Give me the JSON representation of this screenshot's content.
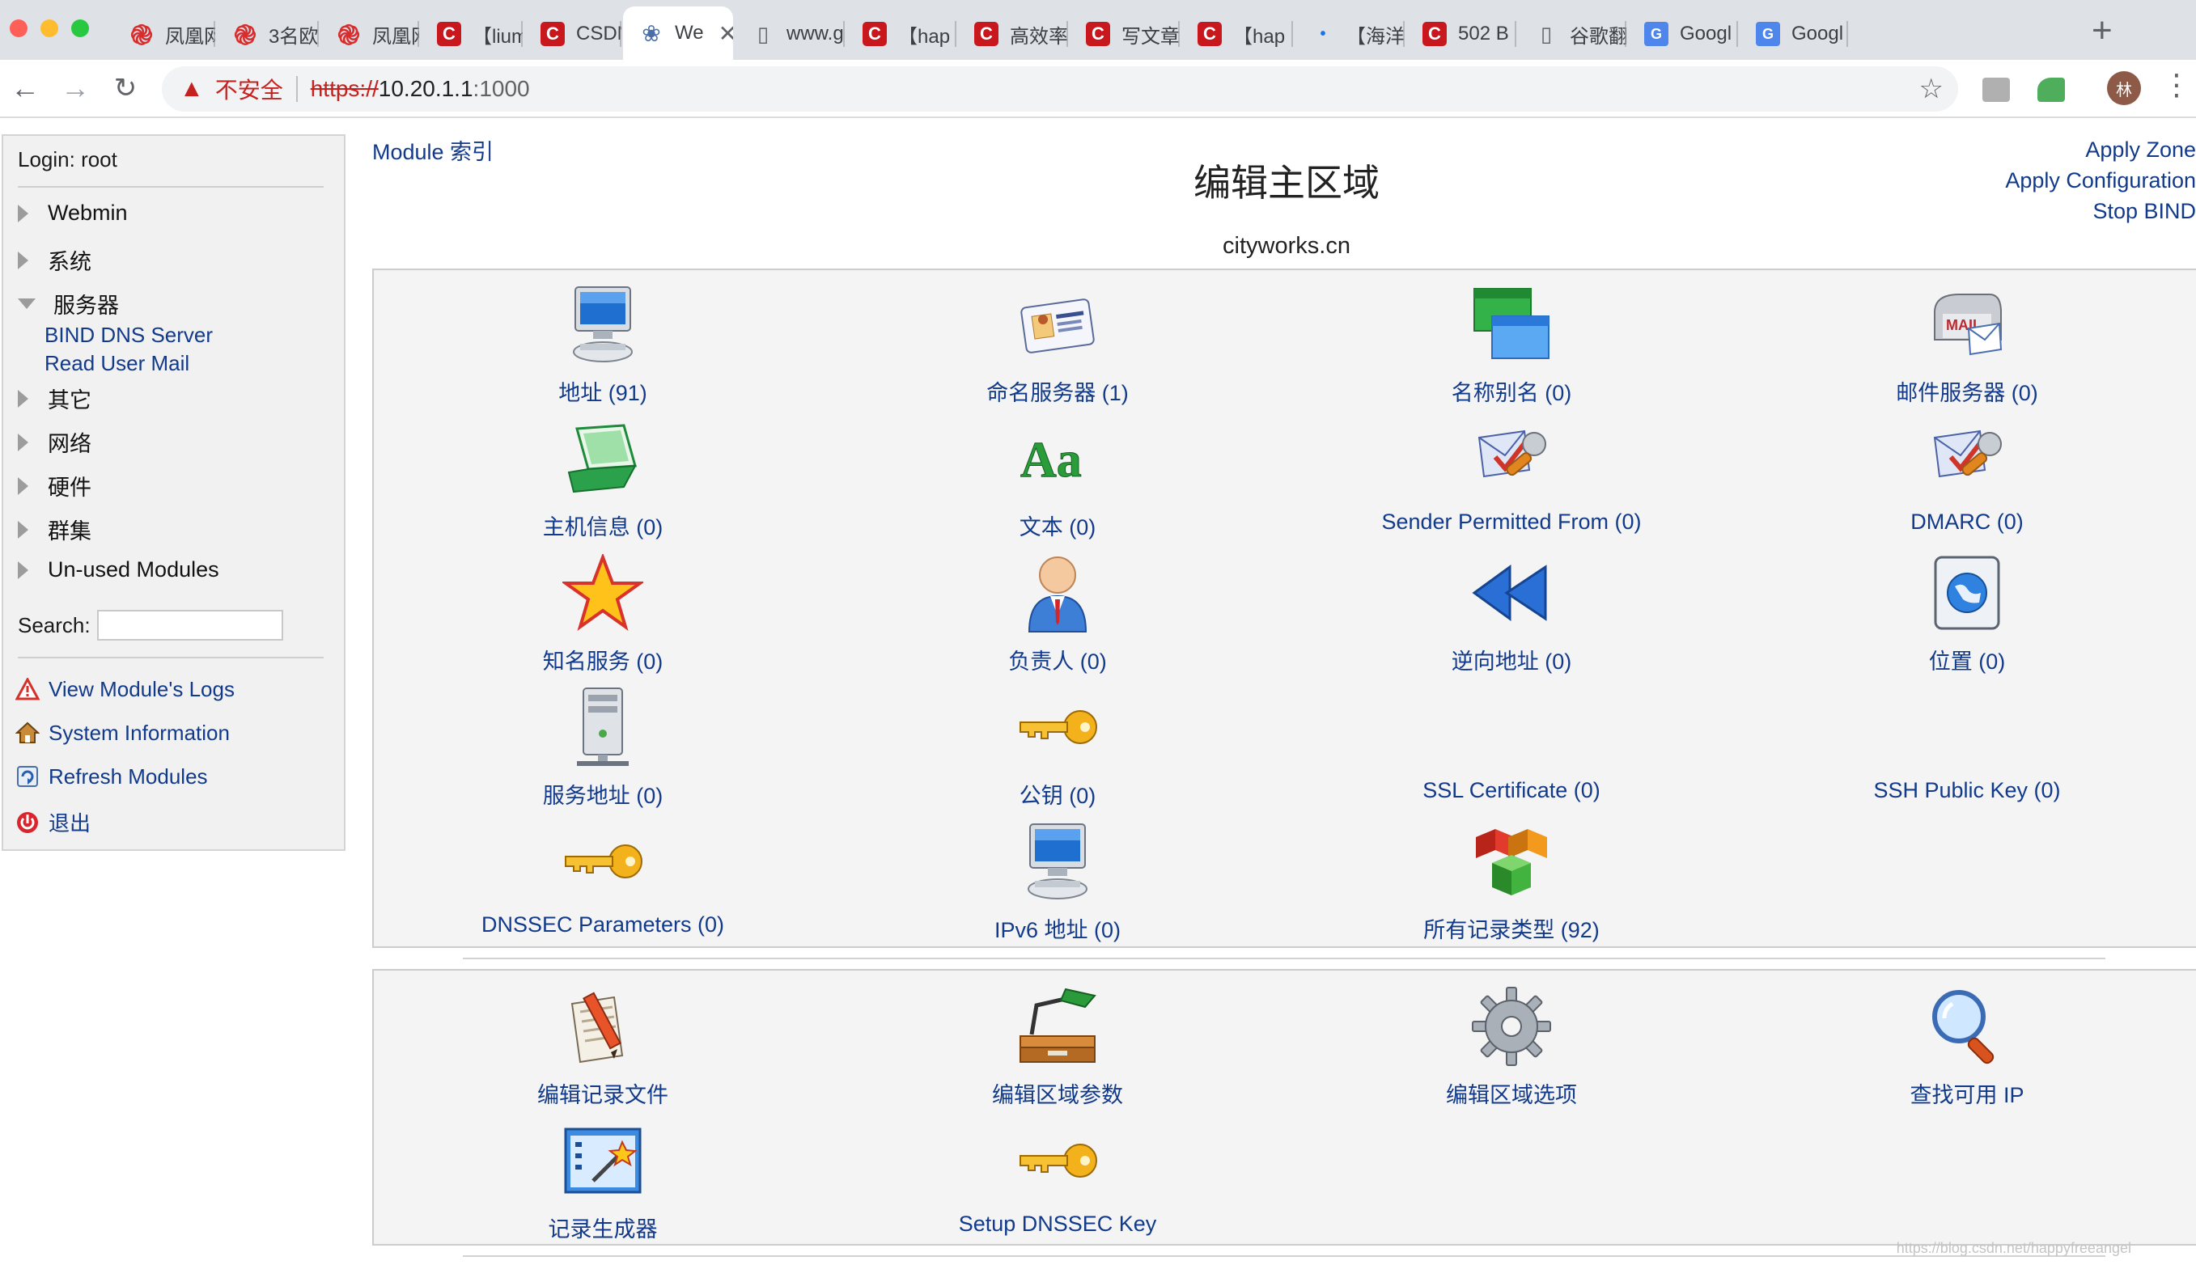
{
  "browser": {
    "tabs": [
      {
        "icon": "swirl",
        "title": "凤凰网"
      },
      {
        "icon": "swirl",
        "title": "3名欧"
      },
      {
        "icon": "swirl",
        "title": "凤凰网"
      },
      {
        "icon": "c",
        "title": "【lium"
      },
      {
        "icon": "c",
        "title": "CSDN"
      },
      {
        "icon": "w",
        "title": "We",
        "active": true
      },
      {
        "icon": "doc",
        "title": "www.g"
      },
      {
        "icon": "c",
        "title": "【hap"
      },
      {
        "icon": "c",
        "title": "高效率"
      },
      {
        "icon": "c",
        "title": "写文章"
      },
      {
        "icon": "c",
        "title": "【hap"
      },
      {
        "icon": "dot",
        "title": "【海洋"
      },
      {
        "icon": "c",
        "title": "502 B"
      },
      {
        "icon": "doc",
        "title": "谷歌翻"
      },
      {
        "icon": "g",
        "title": "Googl"
      },
      {
        "icon": "g",
        "title": "Googl"
      }
    ],
    "new_tab": "+",
    "security_label": "不安全",
    "url_scheme": "https://",
    "url_host": "10.20.1.1",
    "url_port": ":1000",
    "avatar_text": "林"
  },
  "sidebar": {
    "login": "Login: root",
    "categories": [
      {
        "label": "Webmin",
        "expanded": false
      },
      {
        "label": "系统",
        "expanded": false
      },
      {
        "label": "服务器",
        "expanded": true,
        "children": [
          "BIND DNS Server",
          "Read User Mail"
        ]
      },
      {
        "label": "其它",
        "expanded": false
      },
      {
        "label": "网络",
        "expanded": false
      },
      {
        "label": "硬件",
        "expanded": false
      },
      {
        "label": "群集",
        "expanded": false
      },
      {
        "label": "Un-used Modules",
        "expanded": false
      }
    ],
    "search_label": "Search:",
    "search_value": "",
    "actions": [
      {
        "icon": "warning-icon",
        "label": "View Module's Logs"
      },
      {
        "icon": "house-icon",
        "label": "System Information"
      },
      {
        "icon": "refresh-icon",
        "label": "Refresh Modules"
      },
      {
        "icon": "power-icon",
        "label": "退出"
      }
    ]
  },
  "main": {
    "module_index": "Module 索引",
    "title": "编辑主区域",
    "zone_name": "cityworks.cn",
    "right_links": [
      "Apply Zone",
      "Apply Configuration",
      "Stop BIND"
    ],
    "records": [
      {
        "icon": "computer-icon",
        "label": "地址 (91)"
      },
      {
        "icon": "name-card-icon",
        "label": "命名服务器 (1)"
      },
      {
        "icon": "windows-icon",
        "label": "名称别名 (0)"
      },
      {
        "icon": "mailbox-icon",
        "label": "邮件服务器 (0)"
      },
      {
        "icon": "laptop-icon",
        "label": "主机信息 (0)"
      },
      {
        "icon": "text-icon",
        "label": "文本 (0)"
      },
      {
        "icon": "mail-wrench-icon",
        "label": "Sender Permitted From (0)"
      },
      {
        "icon": "mail-wrench-icon",
        "label": "DMARC (0)"
      },
      {
        "icon": "star-icon",
        "label": "知名服务 (0)"
      },
      {
        "icon": "person-icon",
        "label": "负责人 (0)"
      },
      {
        "icon": "rewind-icon",
        "label": "逆向地址 (0)"
      },
      {
        "icon": "globe-icon",
        "label": "位置 (0)"
      },
      {
        "icon": "server-icon",
        "label": "服务地址 (0)"
      },
      {
        "icon": "key-icon",
        "label": "公钥 (0)"
      },
      {
        "icon": "",
        "label": "SSL Certificate (0)"
      },
      {
        "icon": "",
        "label": "SSH Public Key (0)"
      },
      {
        "icon": "key-icon",
        "label": "DNSSEC Parameters (0)"
      },
      {
        "icon": "computer-icon",
        "label": "IPv6 地址 (0)"
      },
      {
        "icon": "cubes-icon",
        "label": "所有记录类型 (92)"
      }
    ],
    "tools": [
      {
        "icon": "edit-file-icon",
        "label": "编辑记录文件"
      },
      {
        "icon": "desk-lamp-icon",
        "label": "编辑区域参数"
      },
      {
        "icon": "gear-icon",
        "label": "编辑区域选项"
      },
      {
        "icon": "magnifier-icon",
        "label": "查找可用 IP"
      },
      {
        "icon": "wizard-icon",
        "label": "记录生成器"
      },
      {
        "icon": "key-icon",
        "label": "Setup DNSSEC Key"
      }
    ],
    "watermark": "https://blog.csdn.net/happyfreeangel"
  }
}
